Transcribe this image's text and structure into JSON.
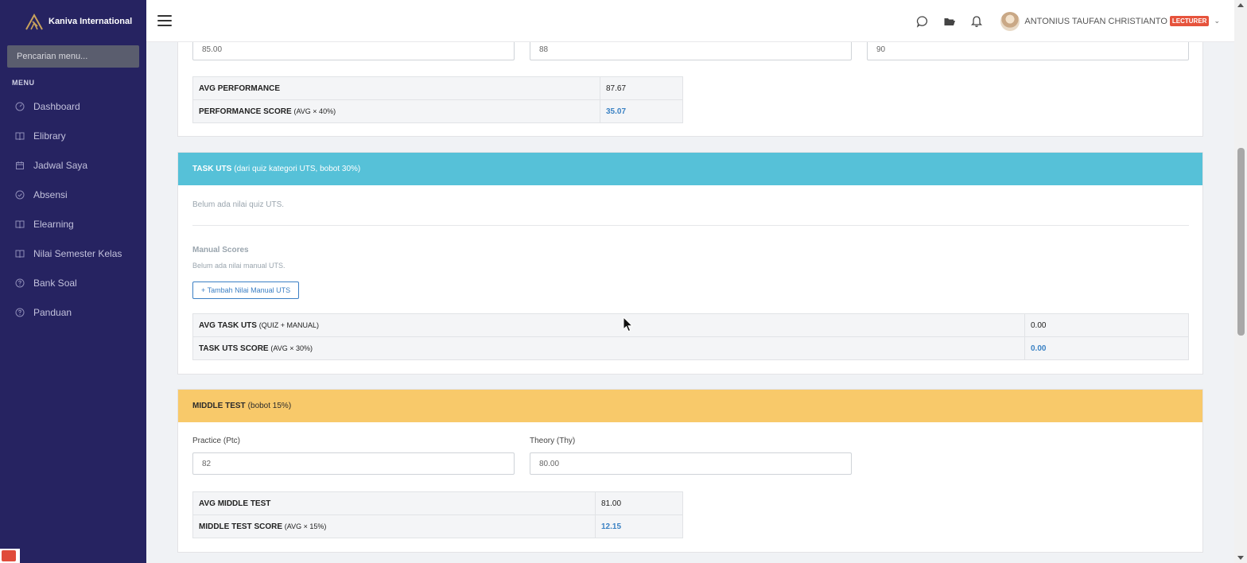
{
  "app": {
    "brand": "Kaniva International"
  },
  "sidebar": {
    "search_placeholder": "Pencarian menu...",
    "menu_heading": "MENU",
    "items": [
      {
        "label": "Dashboard",
        "icon": "gauge-icon"
      },
      {
        "label": "Elibrary",
        "icon": "book-icon"
      },
      {
        "label": "Jadwal Saya",
        "icon": "calendar-icon"
      },
      {
        "label": "Absensi",
        "icon": "check-circle-icon"
      },
      {
        "label": "Elearning",
        "icon": "book-icon"
      },
      {
        "label": "Nilai Semester Kelas",
        "icon": "book-icon"
      },
      {
        "label": "Bank Soal",
        "icon": "help-circle-icon"
      },
      {
        "label": "Panduan",
        "icon": "help-circle-icon"
      }
    ]
  },
  "topbar": {
    "user_name": "ANTONIUS TAUFAN CHRISTIANTO",
    "role": "LECTURER"
  },
  "performance": {
    "inputs": [
      "85.00",
      "88",
      "90"
    ],
    "avg_label": "AVG PERFORMANCE",
    "avg_value": "87.67",
    "score_label": "PERFORMANCE SCORE",
    "score_note": "(AVG × 40%)",
    "score_value": "35.07"
  },
  "task_uts": {
    "title": "TASK UTS",
    "subtitle": "(dari quiz kategori UTS, bobot 30%)",
    "empty_quiz": "Belum ada nilai quiz UTS.",
    "manual_heading": "Manual Scores",
    "empty_manual": "Belum ada nilai manual UTS.",
    "add_button": "+ Tambah Nilai Manual UTS",
    "avg_label": "AVG TASK UTS",
    "avg_note": "(QUIZ + MANUAL)",
    "avg_value": "0.00",
    "score_label": "TASK UTS SCORE",
    "score_note": "(AVG × 30%)",
    "score_value": "0.00"
  },
  "middle_test": {
    "title": "MIDDLE TEST",
    "subtitle": "(bobot 15%)",
    "practice_label": "Practice (Ptc)",
    "practice_value": "82",
    "theory_label": "Theory (Thy)",
    "theory_value": "80.00",
    "avg_label": "AVG MIDDLE TEST",
    "avg_value": "81.00",
    "score_label": "MIDDLE TEST SCORE",
    "score_note": "(AVG × 15%)",
    "score_value": "12.15"
  },
  "colors": {
    "sidebar_bg": "#262361",
    "info_header": "#56c1d8",
    "warning_header": "#f8c96a",
    "accent_blue": "#3b82c4",
    "role_badge": "#e6533c"
  }
}
